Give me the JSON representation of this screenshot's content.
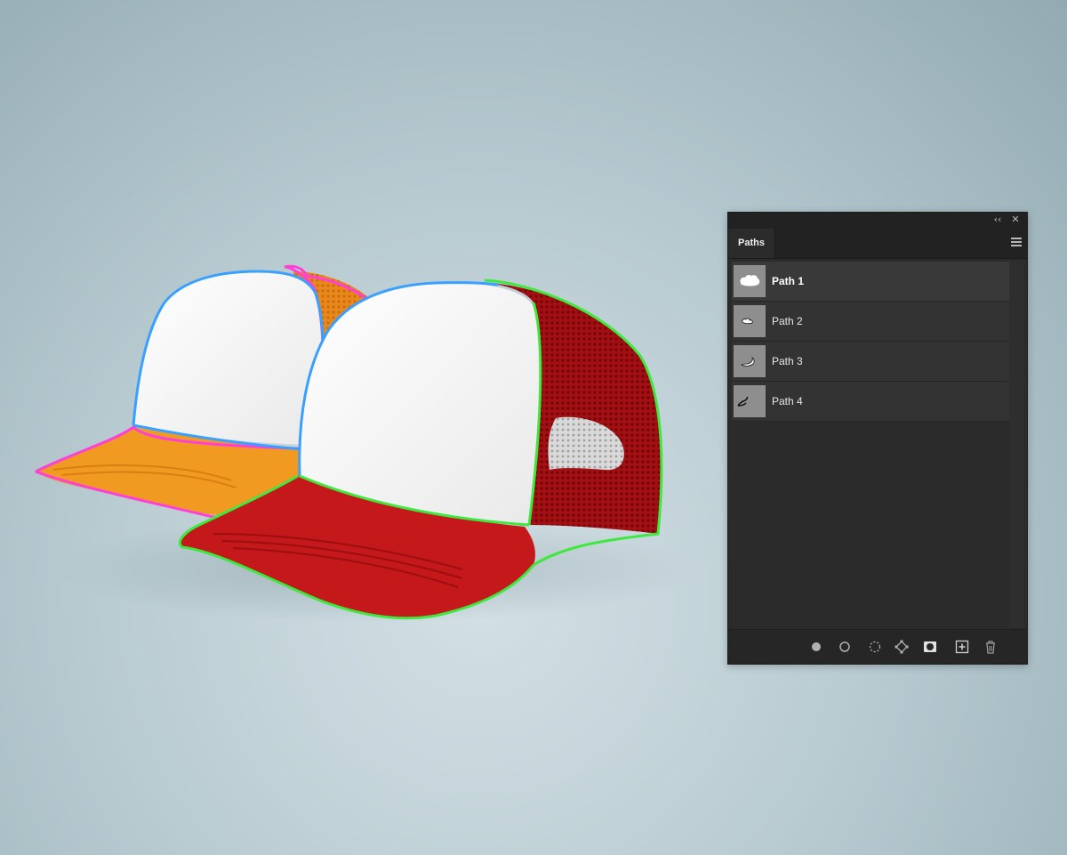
{
  "panel": {
    "tab_label": "Paths",
    "collapse_glyph": "‹‹",
    "close_glyph": "✕",
    "paths": [
      {
        "label": "Path 1",
        "thumbnail": "cloud-shape-icon",
        "selected": true
      },
      {
        "label": "Path 2",
        "thumbnail": "small-shape-icon",
        "selected": false
      },
      {
        "label": "Path 3",
        "thumbnail": "curve-shape-icon",
        "selected": false
      },
      {
        "label": "Path 4",
        "thumbnail": "hook-shape-icon",
        "selected": false
      }
    ],
    "footer_buttons": [
      "fill-path-icon",
      "stroke-path-icon",
      "load-selection-icon",
      "make-work-path-icon",
      "add-mask-icon",
      "new-path-icon",
      "trash-icon"
    ]
  },
  "canvas": {
    "orange_cap_outline_color": "#ff3fd8",
    "white_panel_outline_color": "#3aa0ff",
    "red_cap_outline_color": "#3fe83f",
    "orange_cap_color": "#f39a25",
    "red_cap_color": "#c0181a"
  }
}
